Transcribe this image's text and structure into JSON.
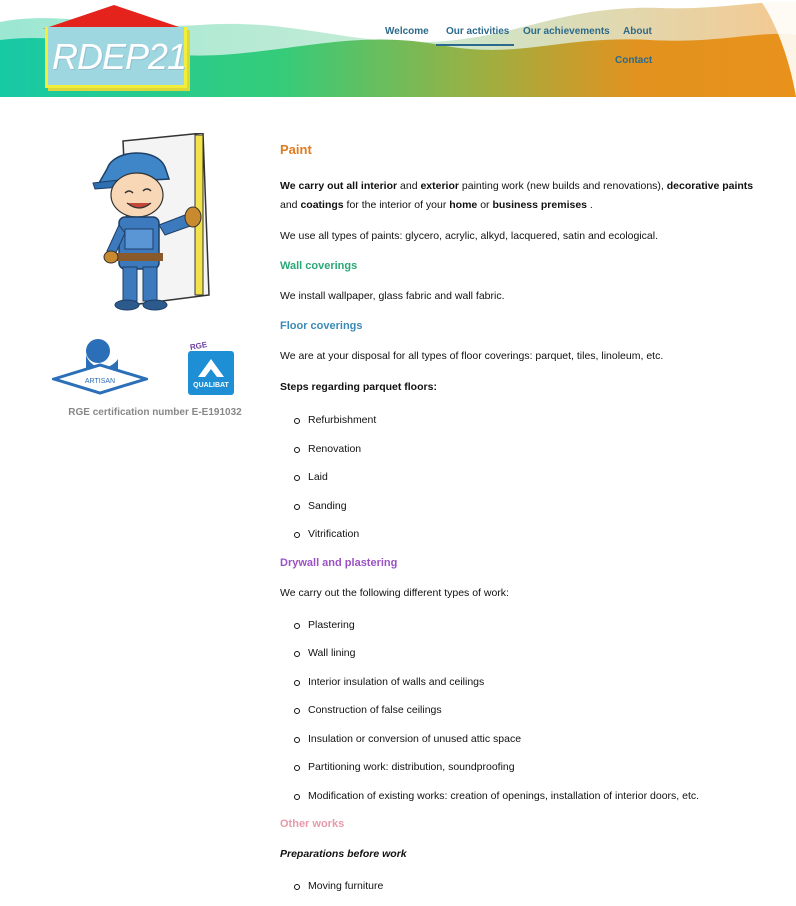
{
  "header": {
    "logo_text": "RDEP21",
    "nav": [
      {
        "label": "Welcome",
        "active": false
      },
      {
        "label": "Our activities",
        "active": true
      },
      {
        "label": "Our achievements",
        "active": false
      },
      {
        "label": "About",
        "active": false
      },
      {
        "label": "Contact",
        "active": false
      }
    ],
    "colors": {
      "nav_text": "#2b6a8c",
      "wave_green": "#2ecf9a",
      "wave_orange": "#e8921e"
    }
  },
  "sidebar": {
    "certifications": [
      {
        "name": "ARTISAN",
        "icon": "artisan-logo"
      },
      {
        "name": "QUALIBAT",
        "badge": "RGE",
        "icon": "qualibat-logo"
      }
    ],
    "cert_number": "RGE certification number E-E191032"
  },
  "content": {
    "paint": {
      "title": "Paint",
      "p1_parts": [
        " We carry out all ",
        "interior",
        " and ",
        "exterior",
        " painting work  (new builds and renovations),  ",
        "decorative paints",
        "  and  ",
        "coatings",
        "  for the interior of your  ",
        "home",
        "  or  ",
        "business premises",
        " ."
      ],
      "p2": "We use all types of paints: glycero, acrylic, alkyd, lacquered, satin and ecological."
    },
    "wall": {
      "title": "Wall coverings",
      "p": "We install wallpaper, glass fabric and wall fabric."
    },
    "floor": {
      "title": "Floor coverings",
      "p": "We are at your disposal for all types of floor coverings: parquet, tiles, linoleum, etc.",
      "steps_title": "Steps regarding parquet floors:",
      "steps": [
        "Refurbishment",
        "Renovation",
        "Laid",
        "Sanding",
        "Vitrification"
      ]
    },
    "drywall": {
      "title": "Drywall and plastering",
      "p": "We carry out the following different types of work:",
      "items": [
        "Plastering",
        "Wall lining",
        "Interior insulation of walls and ceilings",
        "Construction of false ceilings",
        "Insulation or conversion of unused attic space",
        "Partitioning work: distribution, soundproofing",
        "Modification of existing works: creation of openings, installation of interior doors, etc."
      ]
    },
    "other": {
      "title": "Other works",
      "subtitle": "Preparations before work",
      "items": [
        "Moving furniture"
      ]
    }
  }
}
